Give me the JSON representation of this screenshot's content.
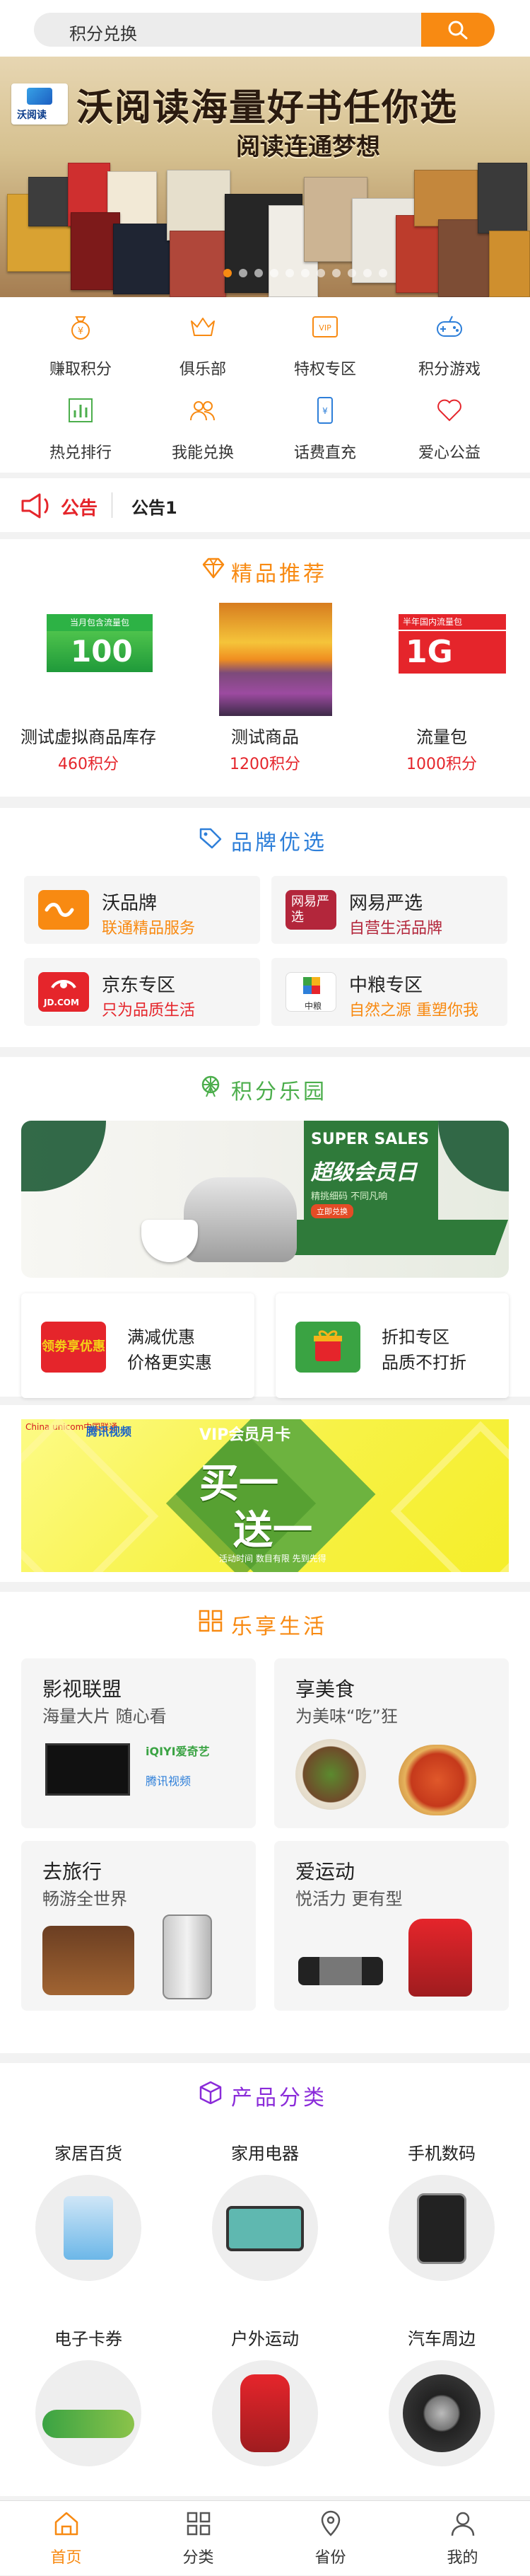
{
  "search": {
    "text": "积分兑换"
  },
  "banner": {
    "logo_text": "沃阅读",
    "title": "沃阅读海量好书任你选",
    "subtitle": "阅读连通梦想"
  },
  "quick": [
    {
      "label": "赚取积分",
      "icon": "money-bag-icon",
      "color": "#f88a12"
    },
    {
      "label": "俱乐部",
      "icon": "crown-icon",
      "color": "#f88a12"
    },
    {
      "label": "特权专区",
      "icon": "vip-icon",
      "color": "#f88a12"
    },
    {
      "label": "积分游戏",
      "icon": "gamepad-icon",
      "color": "#2e7fd9"
    },
    {
      "label": "热兑排行",
      "icon": "bar-chart-icon",
      "color": "#4cae4c"
    },
    {
      "label": "我能兑换",
      "icon": "group-icon",
      "color": "#f88a12"
    },
    {
      "label": "话费直充",
      "icon": "phone-icon",
      "color": "#2e7fd9"
    },
    {
      "label": "爱心公益",
      "icon": "heart-icon",
      "color": "#e5252b"
    }
  ],
  "notice": {
    "title": "公告",
    "text": "公告1"
  },
  "recommend": {
    "title": "精品推荐",
    "items": [
      {
        "name": "测试虚拟商品库存",
        "price": "460积分",
        "img_top": "当月包含流量包",
        "img_big": "100"
      },
      {
        "name": "测试商品",
        "price": "1200积分",
        "img_top": "",
        "img_big": ""
      },
      {
        "name": "流量包",
        "price": "1000积分",
        "img_top": "半年国内流量包",
        "img_big": "1G"
      }
    ]
  },
  "brand": {
    "title": "品牌优选",
    "items": [
      {
        "name": "沃品牌",
        "desc": "联通精品服务",
        "desc_color": "#f88a12",
        "logo_color": "#f88a12"
      },
      {
        "name": "网易严选",
        "desc": "自营生活品牌",
        "desc_color": "#b3263b",
        "logo_color": "#b3263b",
        "logo_text": "网易严选"
      },
      {
        "name": "京东专区",
        "desc": "只为品质生活",
        "desc_color": "#e5252b",
        "logo_color": "#e5252b",
        "logo_text": "JD.COM"
      },
      {
        "name": "中粮专区",
        "desc": "自然之源 重塑你我",
        "desc_color": "#f88a12",
        "logo_color": "#ffffff",
        "logo_text": "中粮"
      }
    ]
  },
  "park": {
    "title": "积分乐园",
    "banner_badge": "SUPER SALES",
    "banner_title": "超级会员日",
    "banner_sub": "精挑细码 不同凡响",
    "banner_btn": "立即兑换",
    "cards": [
      {
        "a": "满减优惠",
        "b": "价格更实惠",
        "badge": "领劵享优惠"
      },
      {
        "a": "折扣专区",
        "b": "品质不打折"
      }
    ]
  },
  "vip": {
    "brand1": "China unicom中国联通",
    "brand2": "腾讯视频",
    "title": "VIP会员月卡",
    "big1": "买一",
    "big2": "送一",
    "small": "活动时间 数目有限 先到先得"
  },
  "life": {
    "title": "乐享生活",
    "items": [
      {
        "t": "影视联盟",
        "d": "海量大片 随心看",
        "logo1": "iQIYI爱奇艺",
        "logo2": "腾讯视频"
      },
      {
        "t": "享美食",
        "d": "为美味“吃”狂"
      },
      {
        "t": "去旅行",
        "d": "畅游全世界"
      },
      {
        "t": "爱运动",
        "d": "悦活力 更有型"
      }
    ]
  },
  "category": {
    "title": "产品分类",
    "items": [
      {
        "name": "家居百货"
      },
      {
        "name": "家用电器"
      },
      {
        "name": "手机数码"
      },
      {
        "name": "电子卡券"
      },
      {
        "name": "户外运动"
      },
      {
        "name": "汽车周边"
      }
    ]
  },
  "tabbar": [
    {
      "label": "首页",
      "icon": "home-icon",
      "active": true
    },
    {
      "label": "分类",
      "icon": "grid-icon"
    },
    {
      "label": "省份",
      "icon": "location-icon"
    },
    {
      "label": "我的",
      "icon": "user-icon"
    }
  ],
  "colors": {
    "accent": "#f88a12",
    "red": "#e5252b",
    "green": "#4cae4c",
    "blue": "#2e7fd9",
    "purple": "#8a2bd9"
  }
}
